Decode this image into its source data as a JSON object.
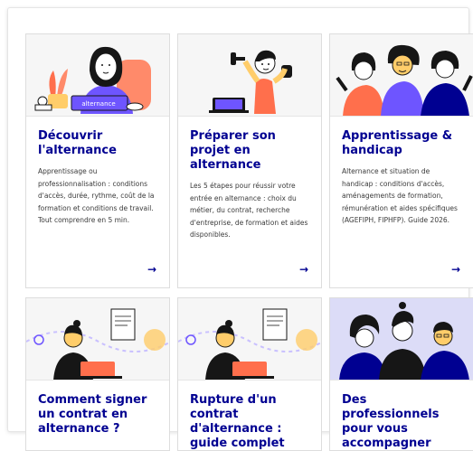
{
  "colors": {
    "title_blue": "#000091",
    "illustration_bg": "#f6f6f6",
    "card_border": "#dddddd",
    "accent_orange": "#ff6f4c",
    "accent_purple": "#6e55ff",
    "accent_navy": "#000091"
  },
  "cards": [
    {
      "title": "Découvrir l'alternance",
      "description": "Apprentissage ou professionnalisation : conditions d'accès, durée, rythme, coût de la formation et conditions de travail. Tout comprendre en 5 min.",
      "illustration_text": "alternance",
      "arrow": "→"
    },
    {
      "title": "Préparer son projet en alternance",
      "description": "Les 5 étapes pour réussir votre entrée en alternance : choix du métier, du contrat, recherche d'entreprise, de formation et aides disponibles.",
      "arrow": "→"
    },
    {
      "title": "Apprentissage & handicap",
      "description": "Alternance et situation de handicap : conditions d'accès, aménagements de formation, rémunération et aides spécifiques (AGEFIPH, FIPHFP). Guide 2026.",
      "arrow": "→"
    },
    {
      "title": "Comment signer un contrat en alternance ?"
    },
    {
      "title": "Rupture d'un contrat d'alternance : guide complet"
    },
    {
      "title": "Des professionnels pour vous accompagner"
    }
  ]
}
